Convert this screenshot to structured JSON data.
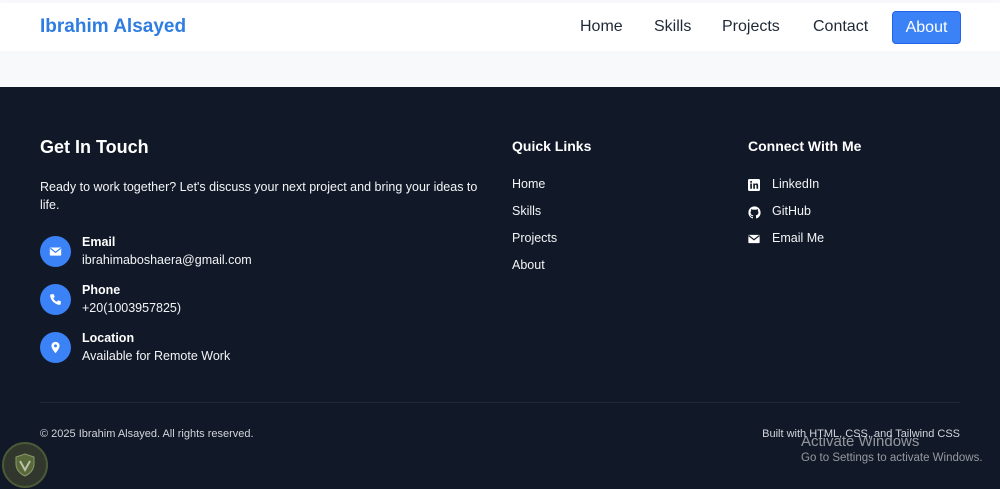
{
  "nav": {
    "brand": "Ibrahim Alsayed",
    "links": [
      "Home",
      "Skills",
      "Projects",
      "Contact"
    ],
    "about": "About"
  },
  "touch": {
    "title": "Get In Touch",
    "description": "Ready to work together? Let's discuss your next project and bring your ideas to life.",
    "contacts": [
      {
        "label": "Email",
        "value": "ibrahimaboshaera@gmail.com",
        "icon": "envelope-icon"
      },
      {
        "label": "Phone",
        "value": "+20(1003957825)",
        "icon": "phone-icon"
      },
      {
        "label": "Location",
        "value": "Available for Remote Work",
        "icon": "location-pin-icon"
      }
    ]
  },
  "quick_links": {
    "title": "Quick Links",
    "items": [
      "Home",
      "Skills",
      "Projects",
      "About"
    ]
  },
  "connect": {
    "title": "Connect With Me",
    "items": [
      {
        "label": "LinkedIn",
        "icon": "linkedin-icon"
      },
      {
        "label": "GitHub",
        "icon": "github-icon"
      },
      {
        "label": "Email Me",
        "icon": "envelope-icon"
      }
    ]
  },
  "footer": {
    "copyright": "© 2025 Ibrahim Alsayed. All rights reserved.",
    "built_with": "Built with HTML, CSS, and Tailwind CSS"
  },
  "windows_watermark": {
    "title": "Activate Windows",
    "subtitle": "Go to Settings to activate Windows."
  },
  "colors": {
    "accent": "#3b82f6",
    "brand": "#2f7de1",
    "footer_bg": "#111827"
  }
}
